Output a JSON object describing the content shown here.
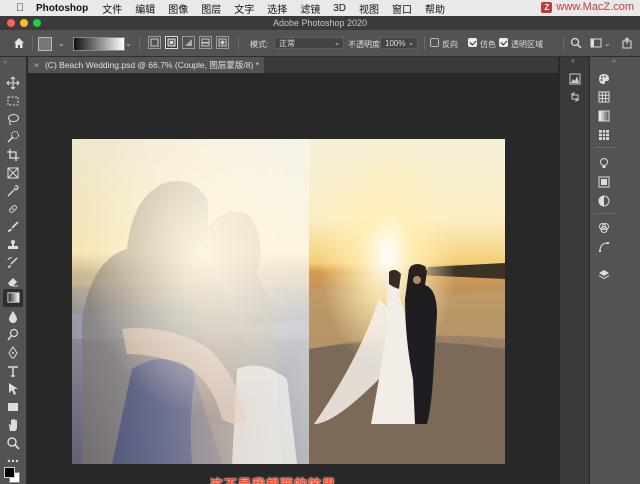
{
  "menubar": {
    "app_name": "Photoshop",
    "items": [
      "文件",
      "编辑",
      "图像",
      "图层",
      "文字",
      "选择",
      "滤镜",
      "3D",
      "视图",
      "窗口",
      "帮助"
    ],
    "watermark_text": "www.MacZ.com"
  },
  "window": {
    "title": "Adobe Photoshop 2020"
  },
  "options_bar": {
    "mode_label": "模式:",
    "mode_value": "正常",
    "opacity_label": "不透明度:",
    "opacity_value": "100%",
    "reverse_label": "反向",
    "dither_label": "仿色",
    "transparency_label": "透明区域",
    "reverse_checked": false,
    "dither_checked": true,
    "transparency_checked": true
  },
  "document_tab": {
    "title": "(C) Beach Wedding.psd @ 66.7% (Couple, 图层蒙版/8) *"
  },
  "subtitle": "这不是我想要的效果",
  "colors": {
    "close": "#ff5f57",
    "minimize": "#febc2e",
    "zoom": "#28c840",
    "subtitle": "#ff4a2a",
    "watermark": "#c03c3c"
  },
  "tools": [
    "move-icon",
    "marquee-icon",
    "lasso-icon",
    "quick-select-icon",
    "crop-icon",
    "frame-icon",
    "eyedropper-icon",
    "healing-brush-icon",
    "brush-icon",
    "stamp-icon",
    "history-brush-icon",
    "eraser-icon",
    "gradient-icon",
    "blur-icon",
    "dodge-icon",
    "pen-icon",
    "type-icon",
    "path-select-icon",
    "rectangle-icon",
    "hand-icon",
    "zoom-icon",
    "more-tools-icon"
  ],
  "panels_left": [
    "histogram-icon",
    "info-icon"
  ],
  "panels_right": [
    "color-icon",
    "swatches-icon",
    "gradients-icon",
    "patterns-icon",
    "learn-icon",
    "libraries-icon",
    "adjustments-icon",
    "channels-icon",
    "paths-icon",
    "layers-icon"
  ]
}
